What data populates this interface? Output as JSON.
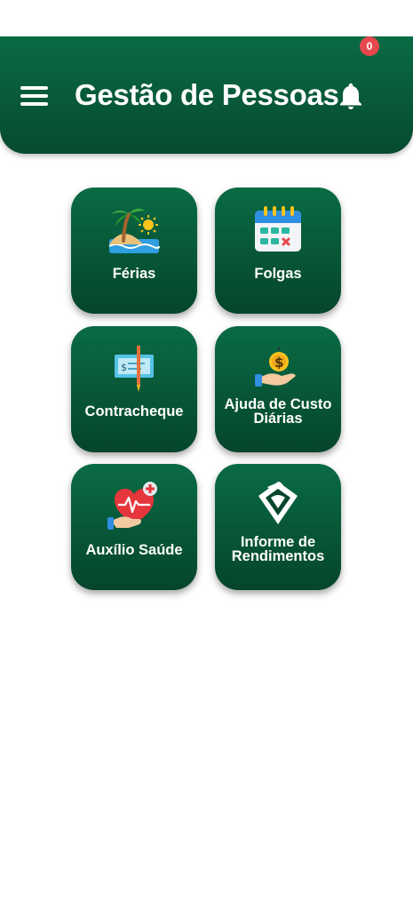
{
  "header": {
    "title": "Gestão de Pessoas",
    "notification_count": "0",
    "menu_icon": "hamburger-menu-icon",
    "bell_icon": "bell-icon"
  },
  "colors": {
    "primary": "#0a6b45",
    "primary_dark": "#05452b",
    "badge": "#e5484d",
    "background": "#ffffff"
  },
  "menu": {
    "items": [
      {
        "label": "Férias",
        "icon": "beach-palm-icon"
      },
      {
        "label": "Folgas",
        "icon": "calendar-icon"
      },
      {
        "label": "Contracheque",
        "icon": "cheque-icon"
      },
      {
        "label": "Ajuda de Custo Diárias",
        "label_line1": "Ajuda de Custo",
        "label_line2": "Diárias",
        "icon": "money-hand-icon"
      },
      {
        "label": "Auxílio Saúde",
        "icon": "health-heart-icon"
      },
      {
        "label": "Informe de Rendimentos",
        "label_line1": "Informe de",
        "label_line2": "Rendimentos",
        "icon": "receita-federal-icon"
      }
    ]
  }
}
